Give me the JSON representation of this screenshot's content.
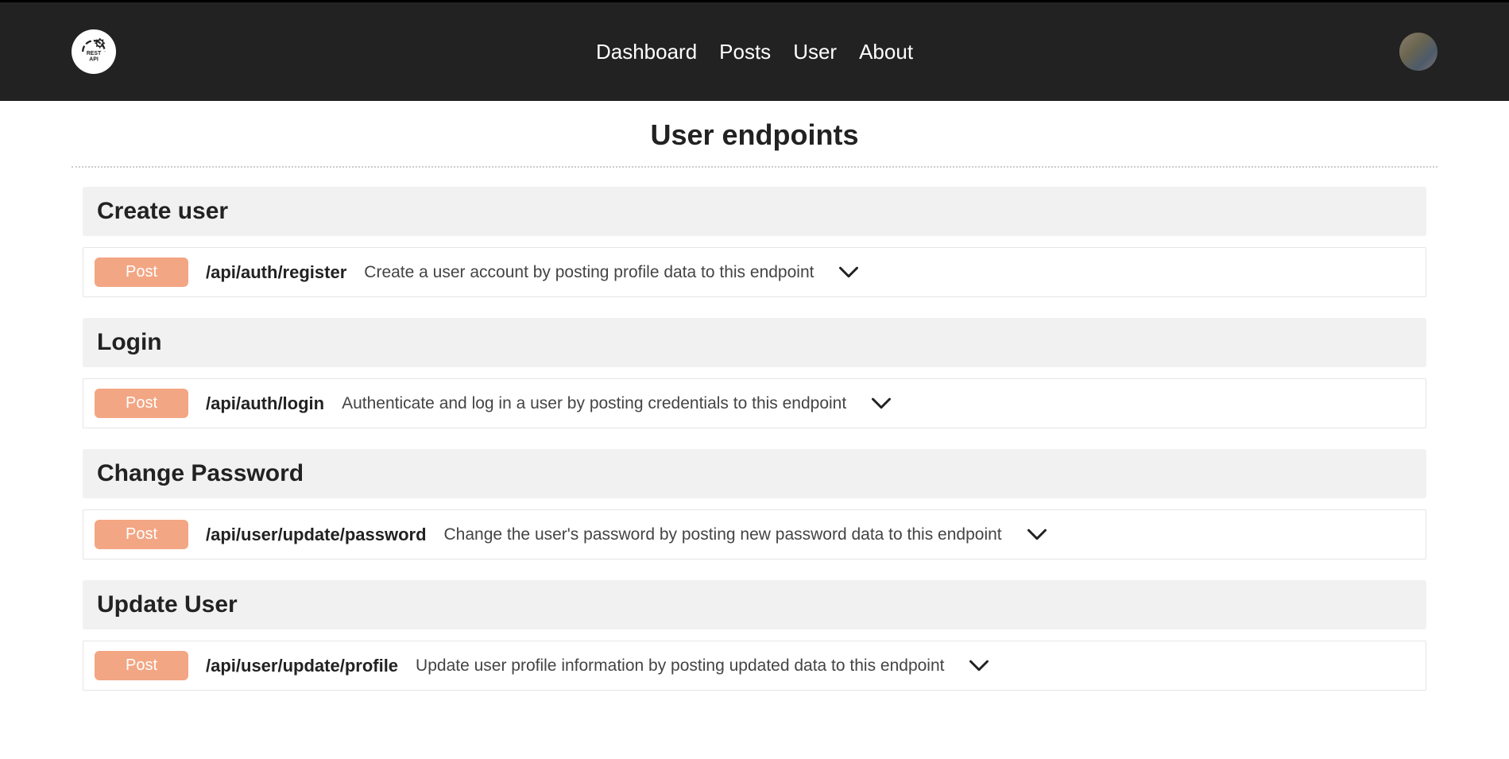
{
  "nav": {
    "items": [
      "Dashboard",
      "Posts",
      "User",
      "About"
    ]
  },
  "page": {
    "title": "User endpoints"
  },
  "sections": [
    {
      "title": "Create user",
      "method": "Post",
      "path": "/api/auth/register",
      "desc": "Create a user account by posting profile data to this endpoint"
    },
    {
      "title": "Login",
      "method": "Post",
      "path": "/api/auth/login",
      "desc": "Authenticate and log in a user by posting credentials to this endpoint"
    },
    {
      "title": "Change Password",
      "method": "Post",
      "path": "/api/user/update/password",
      "desc": "Change the user's password by posting new password data to this endpoint"
    },
    {
      "title": "Update User",
      "method": "Post",
      "path": "/api/user/update/profile",
      "desc": "Update user profile information by posting updated data to this endpoint"
    }
  ],
  "logo": {
    "line1": "REST",
    "line2": "API"
  }
}
